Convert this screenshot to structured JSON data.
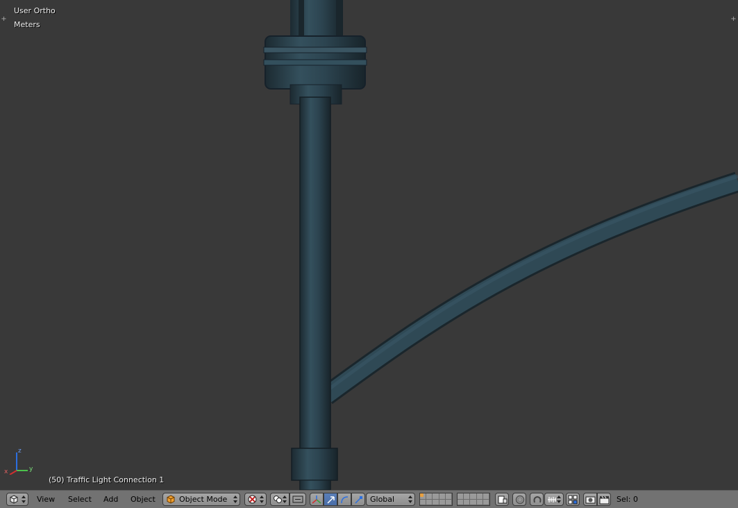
{
  "viewport": {
    "view_name": "User Ortho",
    "units": "Meters",
    "object_info": "(50) Traffic Light Connection 1",
    "axis_labels": {
      "x": "x",
      "y": "y",
      "z": "z"
    }
  },
  "header": {
    "editor_type_icon": "3d-view-icon",
    "menus": [
      "View",
      "Select",
      "Add",
      "Object"
    ],
    "mode": "Object Mode",
    "orientation": "Global",
    "selection": "Sel: 0"
  },
  "colors": {
    "viewport_bg": "#393939",
    "header_bg": "#727272",
    "pole": "#2c3e47",
    "accent": "#5a7fb8"
  }
}
